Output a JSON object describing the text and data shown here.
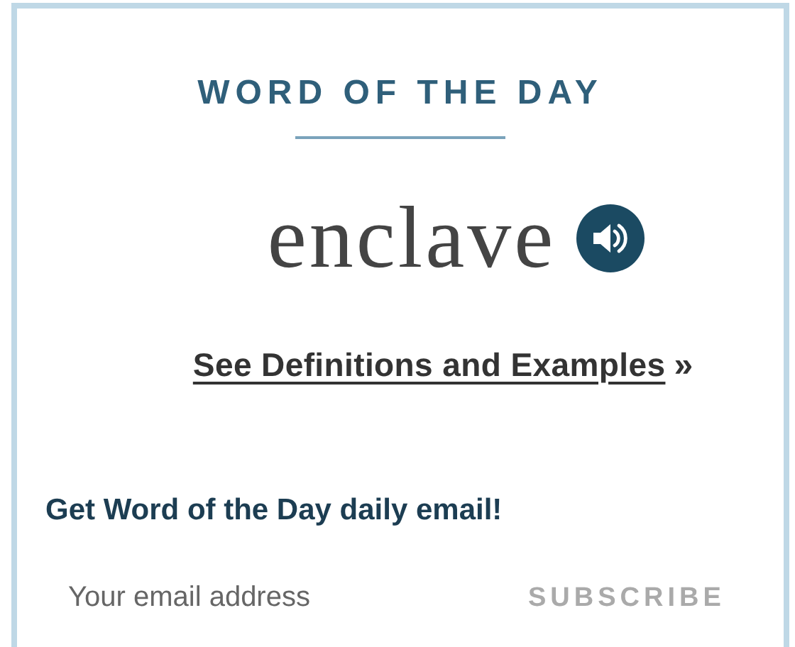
{
  "word_of_the_day": {
    "heading": "WORD OF THE DAY",
    "word": "enclave",
    "link_text": "See Definitions and Examples",
    "link_arrow": "»"
  },
  "newsletter": {
    "heading": "Get Word of the Day daily email!",
    "email_placeholder": "Your email address",
    "subscribe_label": "SUBSCRIBE"
  }
}
